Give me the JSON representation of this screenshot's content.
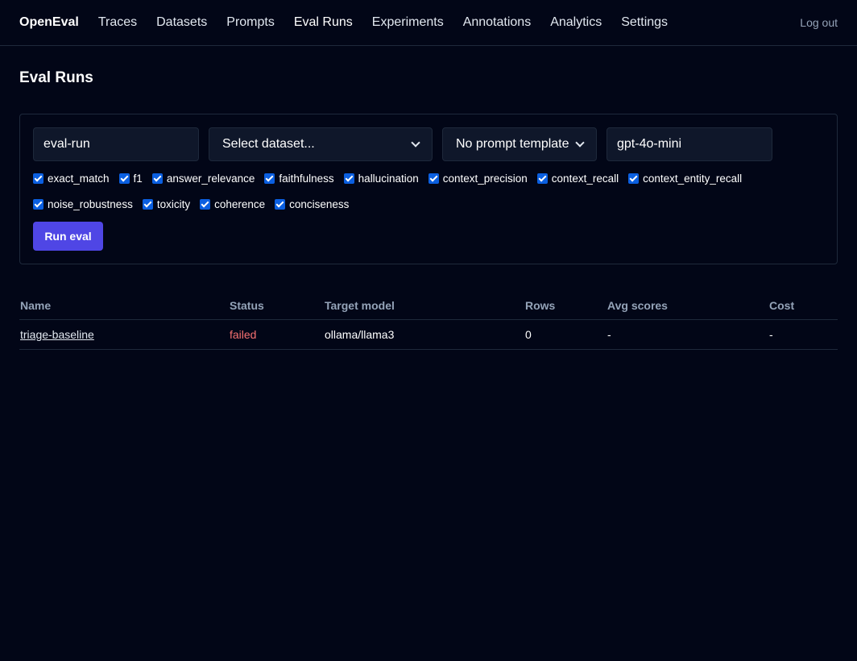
{
  "nav": {
    "brand": "OpenEval",
    "items": [
      "Traces",
      "Datasets",
      "Prompts",
      "Eval Runs",
      "Experiments",
      "Annotations",
      "Analytics",
      "Settings"
    ],
    "logout": "Log out"
  },
  "page": {
    "title": "Eval Runs"
  },
  "form": {
    "run_name": "eval-run",
    "dataset": "Select dataset...",
    "prompt_template": "No prompt template",
    "model": "gpt-4o-mini",
    "metrics_row1": [
      "exact_match",
      "f1",
      "answer_relevance",
      "faithfulness",
      "hallucination",
      "context_precision",
      "context_recall",
      "context_entity_recall"
    ],
    "metrics_row2": [
      "noise_robustness",
      "toxicity",
      "coherence",
      "conciseness"
    ],
    "run_button": "Run eval"
  },
  "table": {
    "headers": [
      "Name",
      "Status",
      "Target model",
      "Rows",
      "Avg scores",
      "Cost"
    ],
    "rows": [
      {
        "name": "triage-baseline",
        "status": "failed",
        "target_model": "ollama/llama3",
        "rows": "0",
        "avg_scores": "-",
        "cost": "-"
      }
    ]
  },
  "colors": {
    "accent": "#4f46e5",
    "failed": "#f87171",
    "background": "#020617"
  }
}
